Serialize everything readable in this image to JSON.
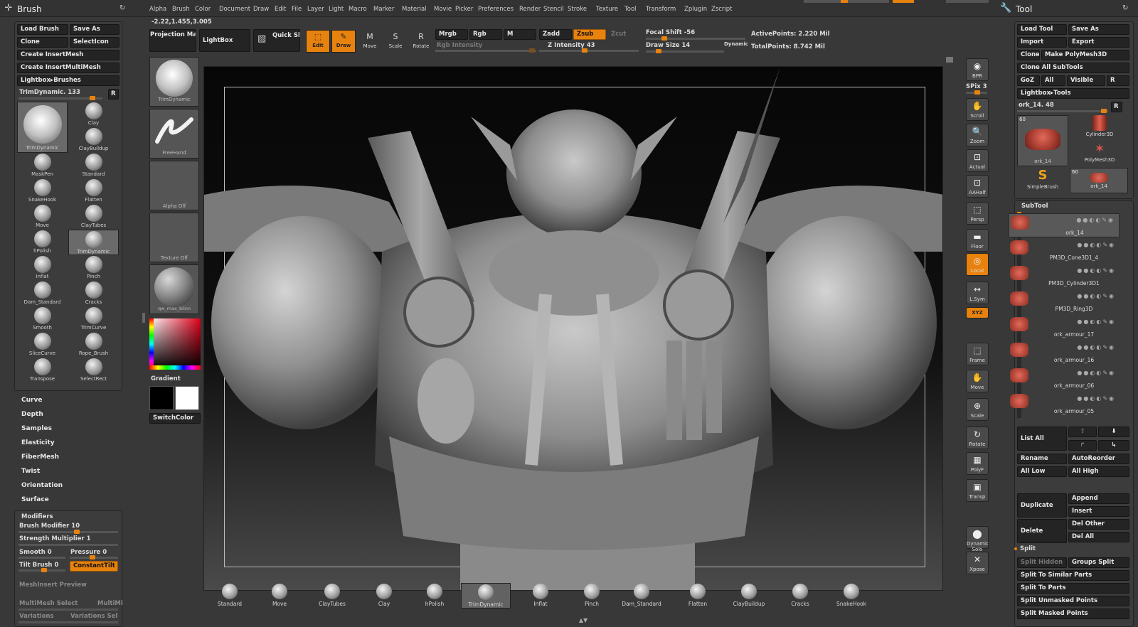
{
  "menubar": {
    "items": [
      "Alpha",
      "Brush",
      "Color",
      "Document",
      "Draw",
      "Edit",
      "File",
      "Layer",
      "Light",
      "Macro",
      "Marker",
      "Material",
      "Movie",
      "Picker",
      "Preferences",
      "Render",
      "Stencil",
      "Stroke",
      "Texture",
      "Tool",
      "Transform",
      "Zplugin",
      "Zscript"
    ]
  },
  "coords": "-2.22,1.455,3.005",
  "brush_panel": {
    "title": "Brush",
    "load_brush": "Load Brush",
    "save_as": "Save As",
    "clone": "Clone",
    "select_icon": "SelectIcon",
    "create_insertmesh": "Create InsertMesh",
    "create_insertmultimesh": "Create InsertMultiMesh",
    "lightbox_brushes": "Lightbox▸Brushes",
    "trim_label": "TrimDynamic. 133",
    "r": "R",
    "big_name": "TrimDynamic",
    "brushes": [
      "Clay",
      "ClayBuildup",
      "MaskPen",
      "Standard",
      "SnakeHook",
      "Flatten",
      "Move",
      "ClayTubes",
      "hPolish",
      "TrimDynamic",
      "Inflat",
      "Pinch",
      "Dam_Standard",
      "Cracks",
      "Smooth",
      "TrimCurve",
      "SliceCurve",
      "Rope_Brush",
      "Transpose",
      "SelectRect"
    ],
    "submenus": [
      "Curve",
      "Depth",
      "Samples",
      "Elasticity",
      "FiberMesh",
      "Twist",
      "Orientation",
      "Surface"
    ],
    "modifiers_title": "Modifiers",
    "brush_modifier": "Brush Modifier 10",
    "strength_multiplier": "Strength Multiplier 1",
    "smooth": "Smooth 0",
    "pressure": "Pressure 0",
    "tilt_brush": "Tilt Brush 0",
    "constant_tilt": "ConstantTilt",
    "meshinsert_preview": "MeshInsert Preview",
    "multimesh_select": "MultiMesh Select",
    "multimi": "MultiMi",
    "variations": "Variations",
    "variations_sel": "Variations Sel"
  },
  "left_shelf": {
    "projection_master": "Projection Master",
    "lightbox": "LightBox",
    "quick_sketch": "Quick Sketch",
    "trim_label": "TrimDynamic",
    "freehand": "FreeHand",
    "alpha_off": "Alpha Off",
    "texture_off": "Texture Off",
    "material": "qw_max_blinn",
    "gradient": "Gradient",
    "switchcolor": "SwitchColor"
  },
  "top_toolbar": {
    "edit": "Edit",
    "draw": "Draw",
    "move": "Move",
    "scale": "Scale",
    "rotate": "Rotate",
    "mrgb": "Mrgb",
    "rgb": "Rgb",
    "m": "M",
    "rgb_intensity": "Rgb Intensity",
    "zadd": "Zadd",
    "zsub": "Zsub",
    "zcut": "Zcut",
    "z_intensity": "Z Intensity 43",
    "focal_shift": "Focal Shift -56",
    "draw_size": "Draw Size 14",
    "dynamic": "Dynamic",
    "active_points": "ActivePoints: 2.220 Mil",
    "total_points": "TotalPoints: 8.742 Mil",
    "z_intensity_value": 43
  },
  "right_shelf": {
    "buttons": [
      "BPR",
      "Scroll",
      "Zoom",
      "Actual",
      "AAHalf",
      "Persp",
      "Floor",
      "Local",
      "L.Sym",
      "XYZ",
      "Frame",
      "Move",
      "Scale",
      "Rotate",
      "PolyF",
      "Transp",
      "Dynamic Solo",
      "Xpose"
    ],
    "spix": "SPix 3"
  },
  "tool_panel": {
    "title": "Tool",
    "load_tool": "Load Tool",
    "save_as": "Save As",
    "import": "Import",
    "export": "Export",
    "clone": "Clone",
    "make_polymesh": "Make PolyMesh3D",
    "clone_all": "Clone All SubTools",
    "goz": "GoZ",
    "all": "All",
    "visible": "Visible",
    "r": "R",
    "lightbox_tools": "Lightbox▸Tools",
    "ork_label": "ork_14. 48",
    "thumb_count_a": "60",
    "thumb_count_b": "60",
    "ork_thumb": "ork_14",
    "cylinder": "Cylinder3D",
    "polymesh": "PolyMesh3D",
    "simplebrush": "SimpleBrush",
    "ork_small": "ork_14",
    "subtool_title": "SubTool",
    "subtools": [
      "ork_14",
      "PM3D_Cone3D1_4",
      "PM3D_Cylinder3D1",
      "PM3D_Ring3D",
      "ork_armour_17",
      "ork_armour_16",
      "ork_armour_06",
      "ork_armour_05"
    ],
    "list_all": "List All",
    "rename": "Rename",
    "autoreorder": "AutoReorder",
    "all_low": "All Low",
    "all_high": "All High",
    "duplicate": "Duplicate",
    "append": "Append",
    "insert": "Insert",
    "delete": "Delete",
    "del_other": "Del Other",
    "del_all": "Del All",
    "split": "Split",
    "split_hidden": "Split Hidden",
    "groups_split": "Groups Split",
    "split_similar": "Split To Similar Parts",
    "split_parts": "Split To Parts",
    "split_unmasked": "Split Unmasked Points",
    "split_masked": "Split Masked Points"
  },
  "bottom_shelf": {
    "brushes": [
      "Standard",
      "Move",
      "ClayTubes",
      "Clay",
      "hPolish",
      "TrimDynamic",
      "Inflat",
      "Pinch",
      "Dam_Standard",
      "Flatten",
      "ClayBuildup",
      "Cracks",
      "SnakeHook"
    ]
  },
  "colors": {
    "accent": "#e8820e",
    "panel": "#3c3c3c",
    "button": "#242424"
  }
}
